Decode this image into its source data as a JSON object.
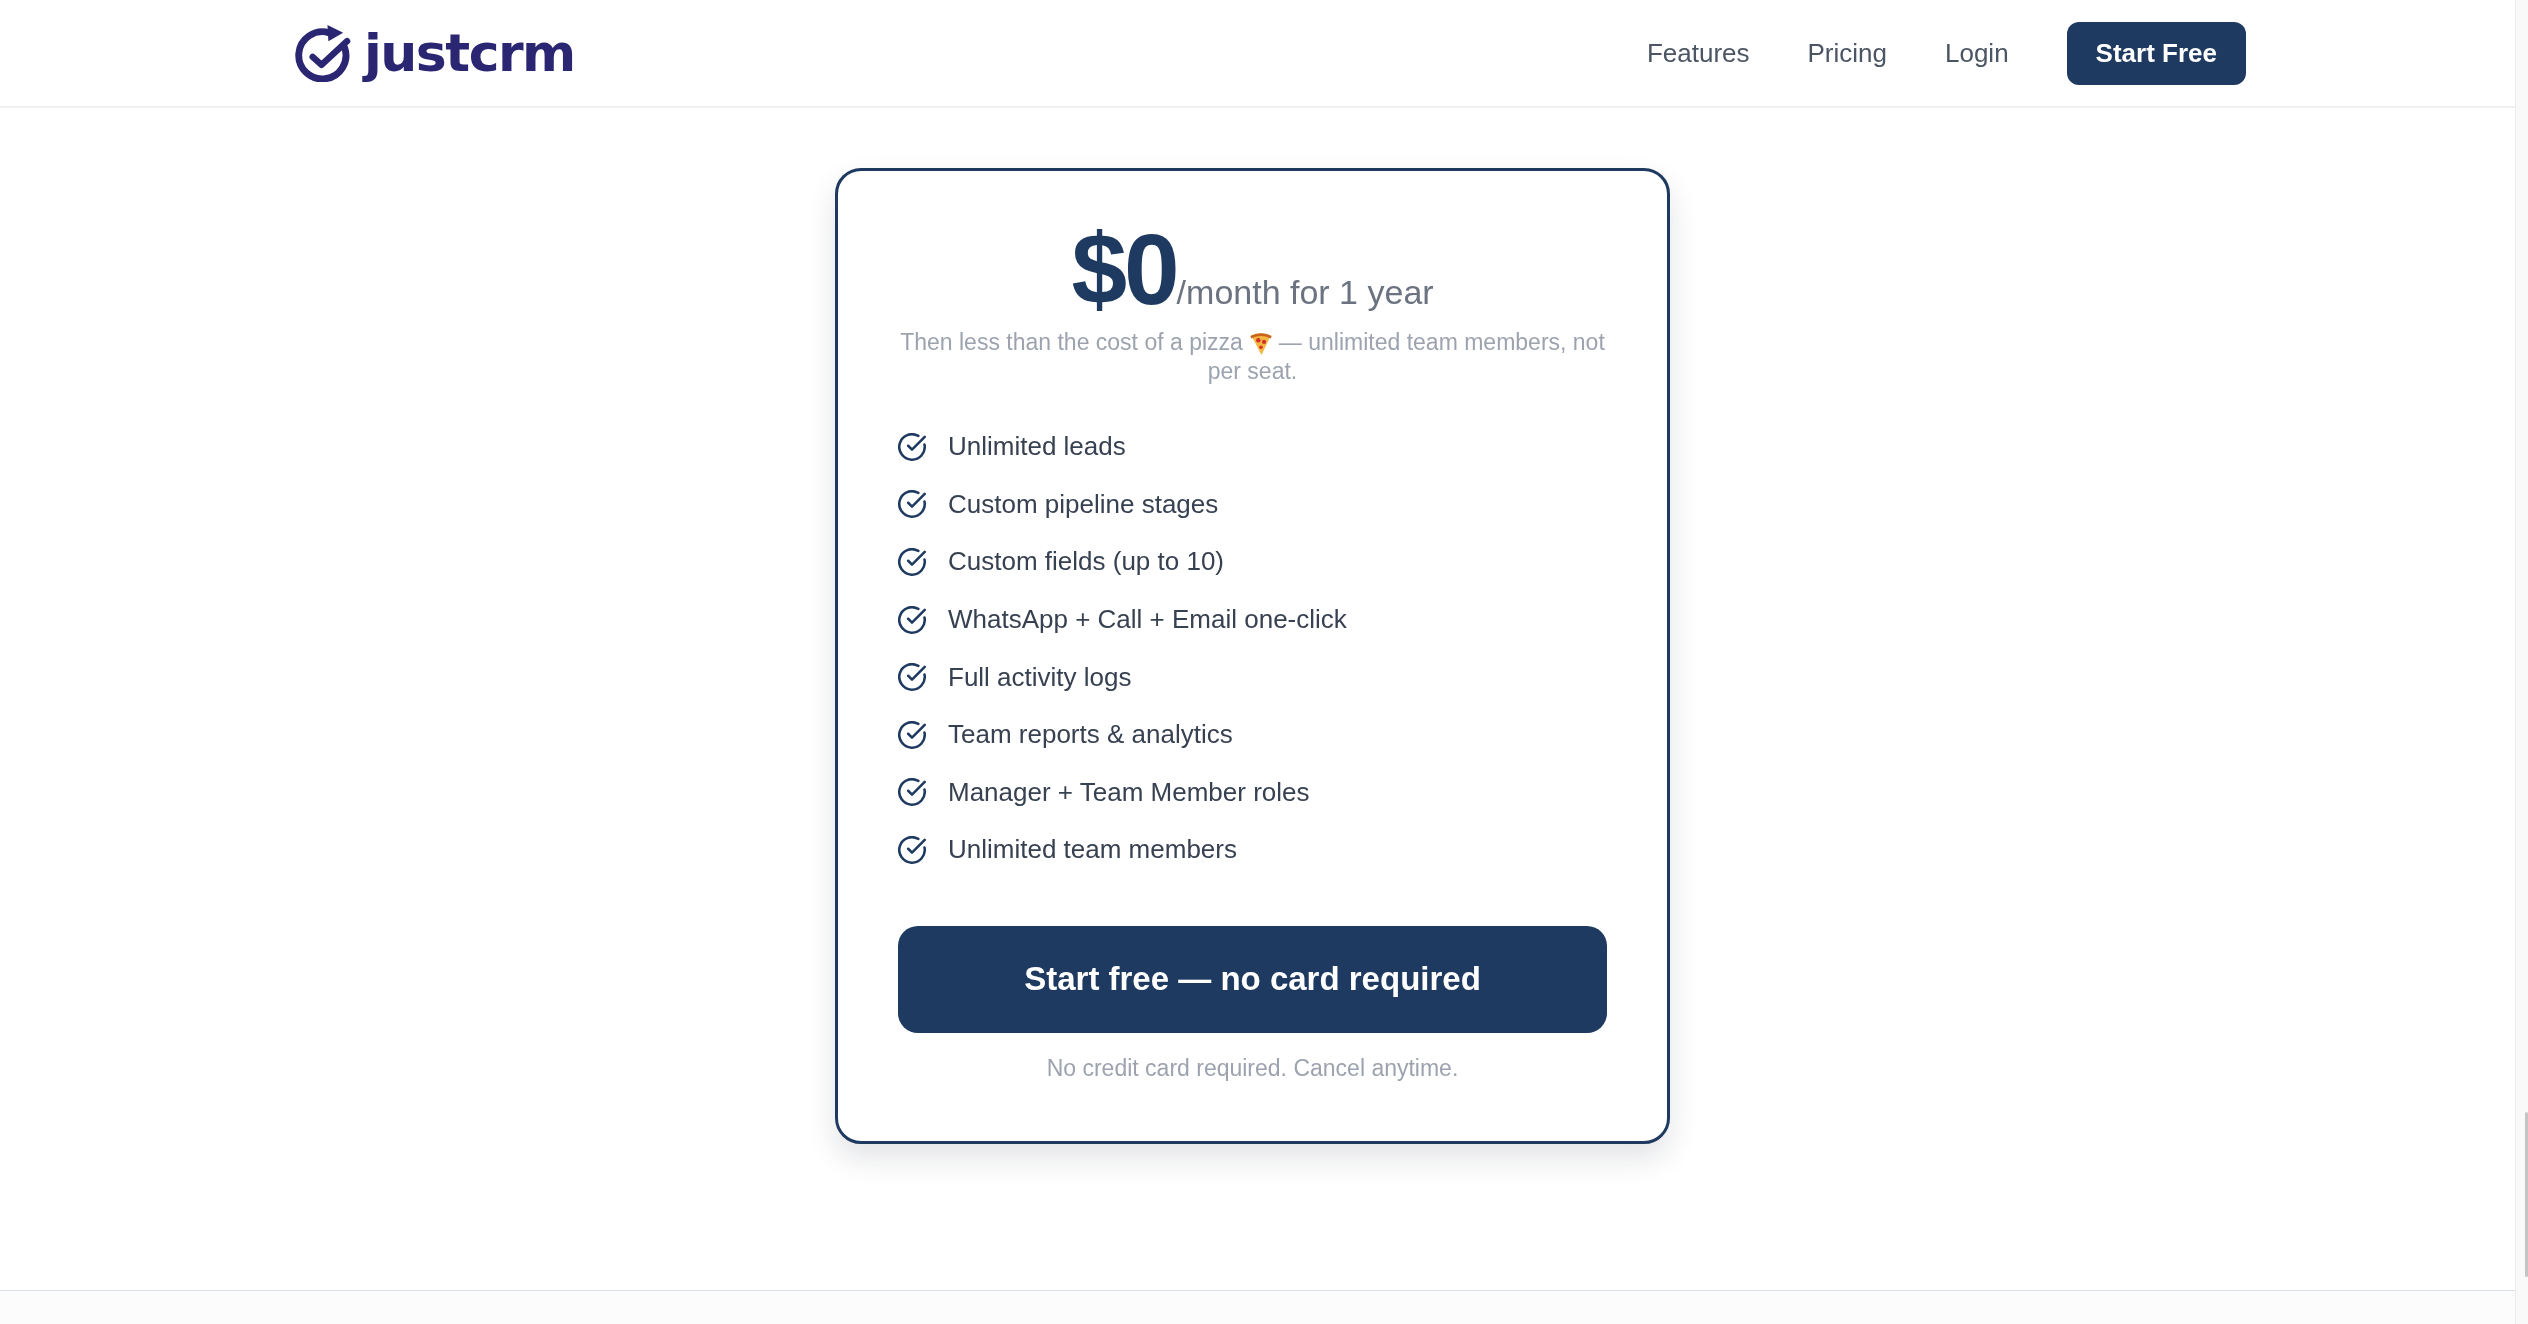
{
  "header": {
    "brand": "justcrm",
    "nav": [
      "Features",
      "Pricing",
      "Login"
    ],
    "cta": "Start Free"
  },
  "plan": {
    "price": "$0",
    "period": "/month for 1 year",
    "note": {
      "lead": "Then less than the cost of a pizza",
      "tail": [
        "— unlimited team members, not",
        "per seat."
      ]
    },
    "features": [
      "Unlimited leads",
      "Custom pipeline stages",
      "Custom fields (up to 10)",
      "WhatsApp + Call + Email one-click",
      "Full activity logs",
      "Team reports & analytics",
      "Manager + Team Member roles",
      "Unlimited team members"
    ],
    "button": "Start free — no card required",
    "fine_print": "No credit card required. Cancel anytime."
  }
}
